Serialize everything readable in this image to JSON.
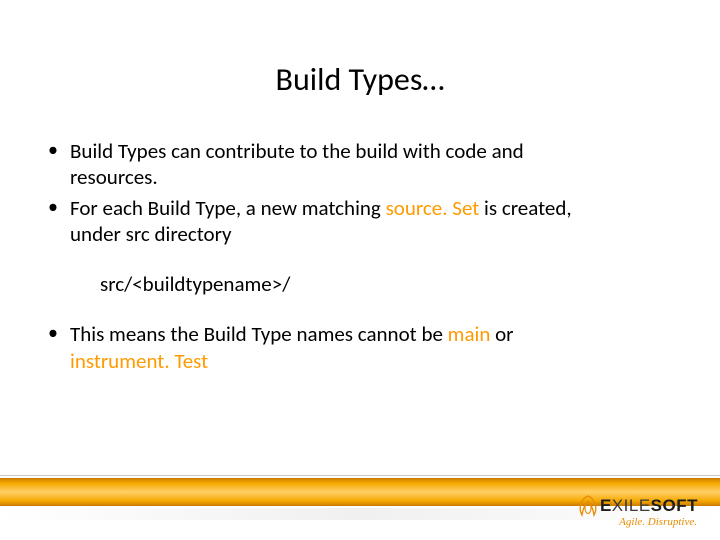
{
  "title": "Build Types…",
  "bullets": {
    "b1a": "Build Types can contribute to the build with code and",
    "b1b": "resources.",
    "b2a": "For each Build Type, a new matching ",
    "b2_hl": "source. Set",
    "b2b": " is created,",
    "b2c": "under src directory",
    "code": "src/<buildtypename>/",
    "b3a": "This means the Build Type names cannot be ",
    "b3_hl1": "main",
    "b3b": " or",
    "b3_hl2": "instrument. Test"
  },
  "logo": {
    "name_heavy": "E",
    "name_light": "XILE",
    "name_heavy2": "SOFT",
    "tagline": "Agile. Disruptive."
  },
  "colors": {
    "accent": "#ff9a00",
    "bar_top": "#f6a800"
  }
}
